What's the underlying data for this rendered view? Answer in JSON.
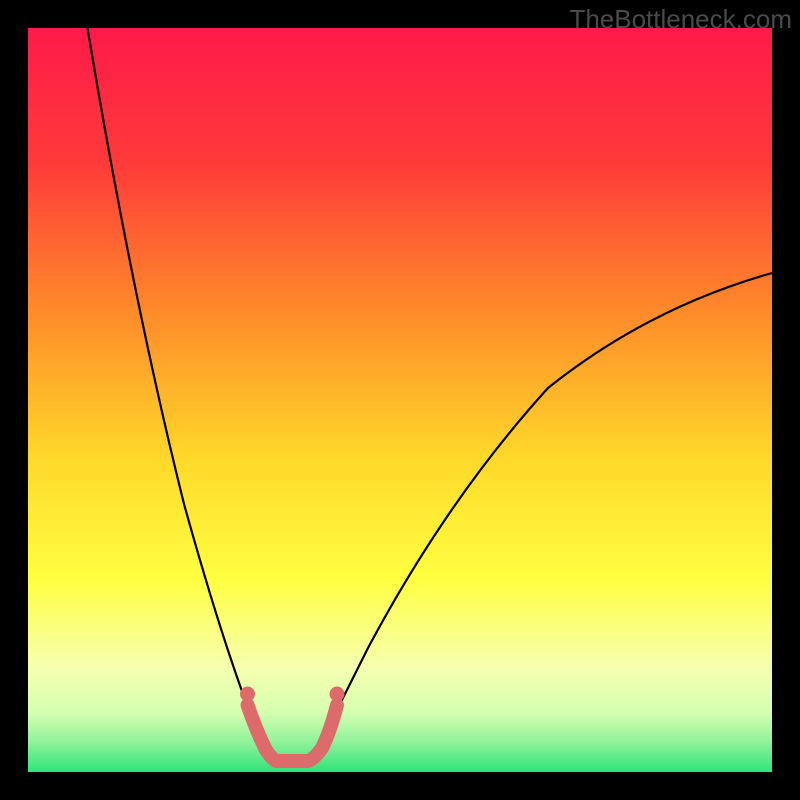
{
  "watermark": "TheBottleneck.com",
  "colors": {
    "background": "#000000",
    "gradient_top": "#ff1a4a",
    "gradient_mid1": "#ff7a2a",
    "gradient_mid2": "#ffe030",
    "gradient_low": "#f6ffb0",
    "gradient_bottom": "#2fe37a",
    "curve": "#000000",
    "marker_stroke": "#dd6b6b",
    "marker_fill": "#dd6b6b"
  },
  "chart_data": {
    "type": "line",
    "title": "",
    "xlabel": "",
    "ylabel": "",
    "xlim": [
      0,
      100
    ],
    "ylim": [
      0,
      100
    ],
    "series": [
      {
        "name": "left-curve",
        "x": [
          8,
          10,
          12,
          14,
          16,
          18,
          20,
          22,
          24,
          26,
          28,
          30,
          32,
          33
        ],
        "values": [
          100,
          88,
          76,
          64,
          53,
          43,
          34,
          26,
          19,
          13,
          8,
          4,
          2,
          1.5
        ]
      },
      {
        "name": "right-curve",
        "x": [
          38,
          40,
          42,
          45,
          48,
          52,
          56,
          60,
          65,
          70,
          75,
          80,
          85,
          90,
          95,
          100
        ],
        "values": [
          1.5,
          3,
          6,
          10,
          15,
          21,
          27,
          33,
          39,
          45,
          50,
          55,
          59,
          62,
          65,
          67
        ]
      },
      {
        "name": "bottom-flat",
        "x": [
          33,
          34,
          35,
          36,
          37,
          38
        ],
        "values": [
          1.5,
          1.5,
          1.5,
          1.5,
          1.5,
          1.5
        ]
      }
    ],
    "markers": {
      "name": "highlight-segment",
      "x": [
        29.5,
        31,
        32,
        33,
        34,
        35,
        36,
        37,
        38,
        39,
        40,
        41.5
      ],
      "values": [
        7,
        4.5,
        2.5,
        1.5,
        1.5,
        1.5,
        1.5,
        1.5,
        1.5,
        2.5,
        4.5,
        7
      ],
      "endpoint_left": {
        "x": 29.5,
        "y": 9
      },
      "endpoint_right": {
        "x": 41.5,
        "y": 9
      }
    },
    "gradient_bands_y": [
      100,
      85,
      70,
      50,
      20,
      12,
      6,
      0
    ]
  }
}
